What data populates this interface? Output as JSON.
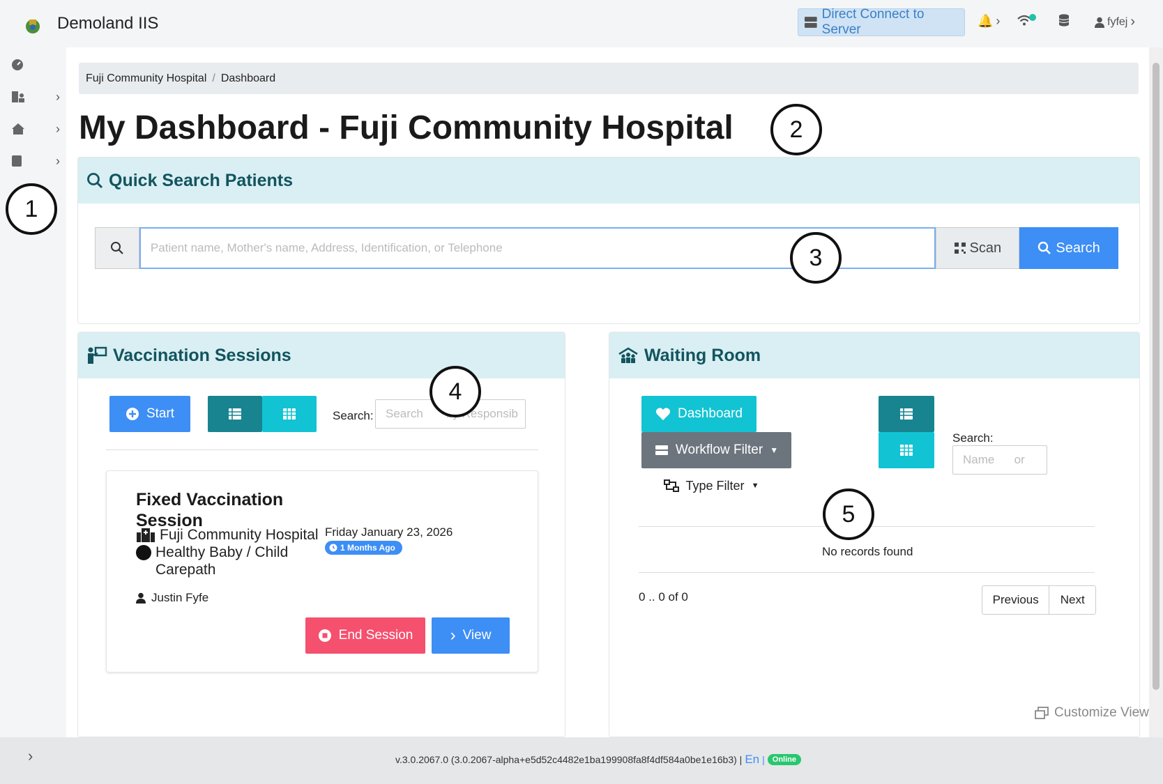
{
  "app": {
    "title": "Demoland IIS"
  },
  "topbar": {
    "direct_connect": "Direct Connect to Server",
    "user": "fyfej"
  },
  "breadcrumb": {
    "items": [
      "Fuji Community Hospital",
      "Dashboard"
    ]
  },
  "page_title": "My Dashboard - Fuji Community Hospital",
  "quick_search": {
    "title": "Quick Search Patients",
    "placeholder": "Patient name, Mother's name, Address, Identification, or Telephone",
    "scan_label": "Scan",
    "search_label": "Search"
  },
  "sessions": {
    "title": "Vaccination Sessions",
    "start_label": "Start",
    "search_label": "Search:",
    "search_placeholder": "Search       by Responsib",
    "card": {
      "title": "Fixed Vaccination Session",
      "facility": "Fuji Community Hospital",
      "carepath": "Healthy Baby / Child Carepath",
      "date": "Friday January 23, 2026",
      "badge": "1 Months Ago",
      "user": "Justin Fyfe",
      "end_label": "End Session",
      "view_label": "View"
    }
  },
  "waiting_room": {
    "title": "Waiting Room",
    "dashboard_label": "Dashboard",
    "workflow_label": "Workflow Filter",
    "type_label": "Type Filter",
    "search_label": "Search:",
    "search_placeholder": "Name      or",
    "empty": "No records found",
    "range": "0 .. 0 of 0",
    "prev_label": "Previous",
    "next_label": "Next"
  },
  "customize_label": "Customize View",
  "footer": {
    "version": "v.3.0.2067.0 (3.0.2067-alpha+e5d52c4482e1ba199908fa8f4df584a0be1e16b3) |",
    "lang": "En",
    "status": "Online"
  },
  "markers": [
    "1",
    "2",
    "3",
    "4",
    "5"
  ],
  "colors": {
    "primary": "#3d8ef5",
    "teal": "#12c3d3",
    "dark_teal": "#178490",
    "danger": "#f5506e",
    "header_bg": "#d9eff3",
    "workflow": "#6c757d"
  }
}
